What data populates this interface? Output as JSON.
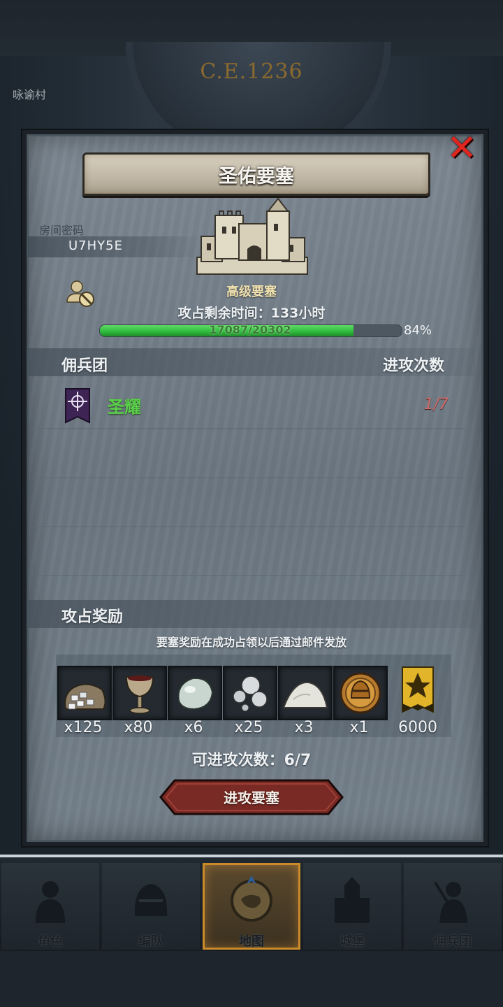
{
  "background": {
    "era": "C.E.1236",
    "village": "咏谕村"
  },
  "panel": {
    "title": "圣佑要塞",
    "room_label": "房间密码",
    "room_code": "U7HY5E",
    "fort_tier": "高级要塞",
    "time_left": "攻占剩余时间：133小时",
    "progress_text": "17087/20302",
    "progress_value": 0.84,
    "progress_pct": "84%",
    "section_guild": "佣兵团",
    "section_attacks": "进攻次数",
    "guilds": [
      {
        "name": "圣耀",
        "attacks": "1/7"
      }
    ],
    "section_rewards": "攻占奖励",
    "reward_note": "要塞奖励在成功占领以后通过邮件发放",
    "rewards": [
      {
        "icon": "silver-ore-sack-icon",
        "qty": "x125"
      },
      {
        "icon": "goblet-icon",
        "qty": "x80"
      },
      {
        "icon": "gem-stone-icon",
        "qty": "x6"
      },
      {
        "icon": "pearls-icon",
        "qty": "x25"
      },
      {
        "icon": "salt-pile-icon",
        "qty": "x3"
      },
      {
        "icon": "knight-helmet-coin-icon",
        "qty": "x1"
      },
      {
        "icon": "gold-banner-icon",
        "qty": "6000"
      }
    ],
    "attack_count": "可进攻次数：6/7",
    "attack_button": "进攻要塞"
  },
  "nav": [
    {
      "label": "角色",
      "icon": "knight-icon",
      "active": false
    },
    {
      "label": "编队",
      "icon": "helmet-icon",
      "active": false
    },
    {
      "label": "地图",
      "icon": "map-compass-icon",
      "active": true
    },
    {
      "label": "城堡",
      "icon": "castle-icon",
      "active": false
    },
    {
      "label": "佣兵团",
      "icon": "warrior-icon",
      "active": false
    }
  ],
  "colors": {
    "progress": "#2fb83c",
    "guild_name": "#5bd04a",
    "attacks_count": "#d06a6a",
    "close": "#e0261f",
    "button": "#7a2a24"
  }
}
